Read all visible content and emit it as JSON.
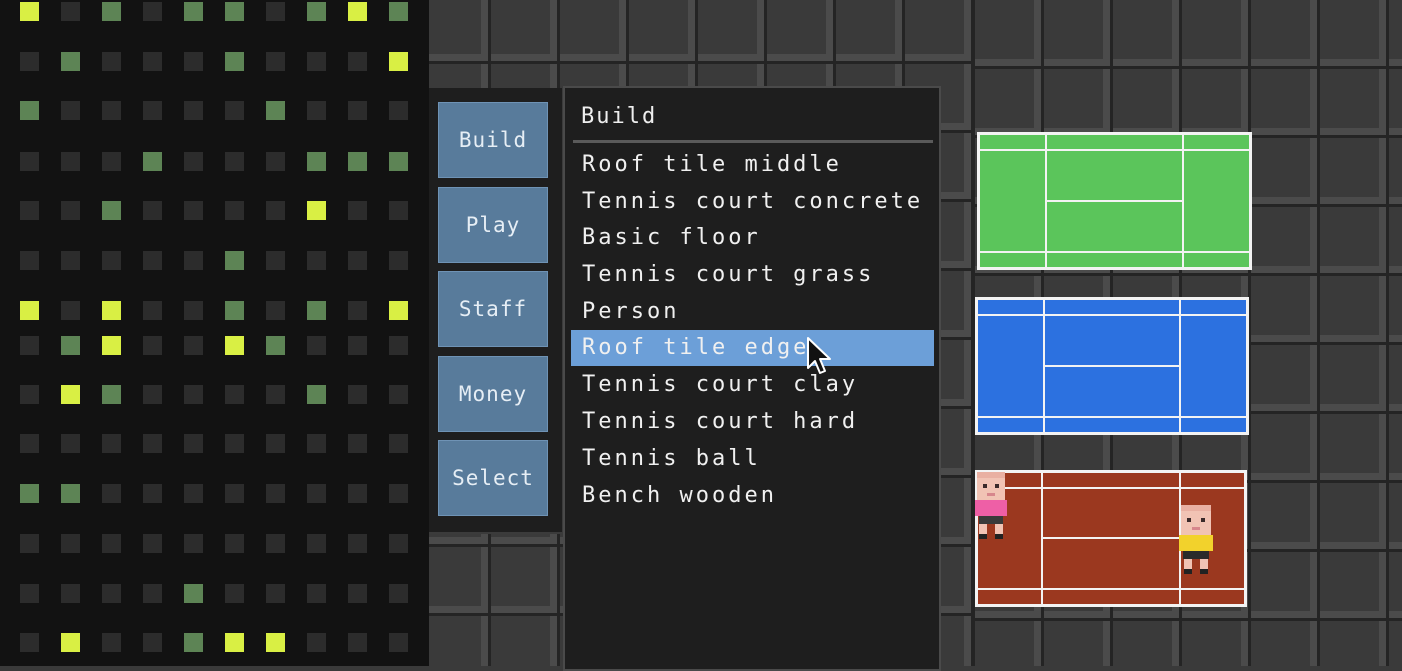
{
  "colors": {
    "button": "#587b9b",
    "menu_bg": "#1e1e1e",
    "selected_row": "#6c9fd8",
    "grass": "#5bc55b",
    "hard": "#2c71e0",
    "clay": "#9b381f",
    "led_off": "#2c2c2c",
    "led_mid": "#5d8455",
    "led_lite": "#9bbc5e",
    "led_bright": "#d9ef44"
  },
  "led_grid": {
    "rows": [
      "2.1.11.121",
      ".1...1...2",
      "1.....1...",
      "...1...111",
      "..1....2..",
      ".....1....",
      "2.2..1.1.2",
      ".12..21...",
      ".21....1..",
      "..........",
      "11........",
      "..........",
      "....1.....",
      ".2..122..."
    ],
    "legend": {
      ".": "off",
      "1": "mid",
      "2": "bright"
    }
  },
  "side_buttons": [
    {
      "label": "Build"
    },
    {
      "label": "Play"
    },
    {
      "label": "Staff"
    },
    {
      "label": "Money"
    },
    {
      "label": "Select"
    }
  ],
  "build_menu": {
    "title": "Build",
    "items": [
      {
        "label": "Roof tile middle"
      },
      {
        "label": "Tennis court concrete"
      },
      {
        "label": "Basic floor"
      },
      {
        "label": "Tennis court grass"
      },
      {
        "label": "Person"
      },
      {
        "label": "Roof tile edge"
      },
      {
        "label": "Tennis court clay"
      },
      {
        "label": "Tennis court hard"
      },
      {
        "label": "Tennis ball"
      },
      {
        "label": "Bench wooden"
      }
    ],
    "selected_index": 5
  },
  "courts": [
    {
      "surface": "grass"
    },
    {
      "surface": "hard"
    },
    {
      "surface": "clay"
    }
  ],
  "players": [
    {
      "shirt": "pink"
    },
    {
      "shirt": "yellow"
    }
  ]
}
